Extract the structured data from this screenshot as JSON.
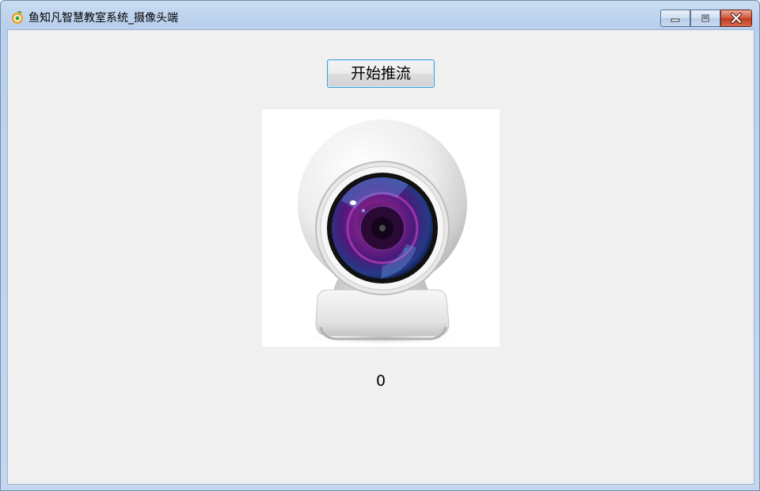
{
  "window": {
    "title": "鱼知凡智慧教室系统_摄像头端",
    "controls": {
      "minimize_icon": "minimize-icon",
      "maximize_icon": "restore-icon",
      "close_icon": "close-icon"
    },
    "colors": {
      "titlebar": "#b9d0ec",
      "client_bg": "#f0f0f0",
      "close_button": "#c23a1f",
      "button_focus_border": "#3c9ed8"
    }
  },
  "main": {
    "push_button_label": "开始推流",
    "camera_image_icon": "webcam-image",
    "counter_value": "0"
  }
}
